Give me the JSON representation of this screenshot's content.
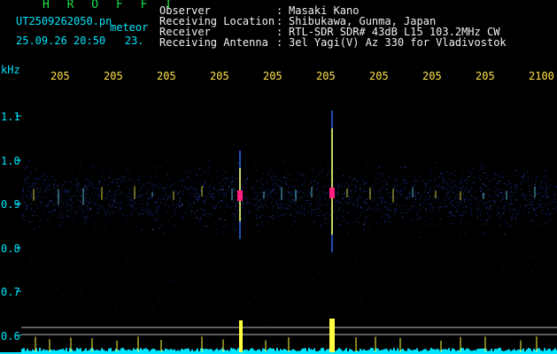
{
  "header": {
    "title": "H R O F F T",
    "filename": "UT2509262050.pn",
    "tag": "meteor",
    "datetime": "25.09.26 20:50",
    "count": "23."
  },
  "meta": [
    {
      "label": "Observer",
      "colon": ":",
      "value": "Masaki Kano"
    },
    {
      "label": "Receiving Location",
      "colon": ":",
      "value": "Shibukawa, Gunma, Japan"
    },
    {
      "label": "Receiver",
      "colon": ":",
      "value": "RTL-SDR SDR# 43dB L15 103.2MHz CW"
    },
    {
      "label": "Receiving Antenna",
      "colon": ":",
      "value": "3el Yagi(V) Az 330 for Vladivostok"
    }
  ],
  "axes": {
    "y_unit": "kHz",
    "y_ticks": [
      "1.1",
      "1.0",
      "0.9",
      "0.8",
      "0.7",
      "0.6"
    ],
    "x_ticks": [
      "205",
      "205",
      "205",
      "205",
      "205",
      "205",
      "205",
      "205",
      "205",
      "2100"
    ]
  },
  "colors": {
    "background": "#000000",
    "labels": "#00e5ff",
    "meta_text": "#f2f2f2",
    "title": "#22e04a",
    "meteor_trace": "#ffff40",
    "meteor_core": "#ff2080",
    "noise": "#1e3cb4",
    "baseline": "#00e5ff"
  }
}
